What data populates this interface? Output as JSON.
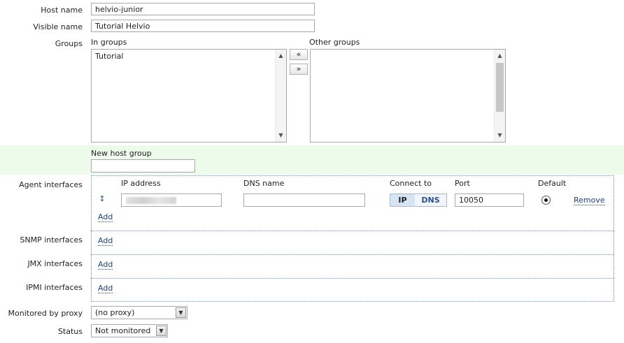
{
  "host": {
    "host_name_label": "Host name",
    "host_name_value": "helvio-junior",
    "visible_name_label": "Visible name",
    "visible_name_value": "Tutorial Helvio"
  },
  "groups": {
    "label": "Groups",
    "in_groups_label": "In groups",
    "in_groups_items": [
      "Tutorial"
    ],
    "other_groups_label": "Other groups",
    "move_left": "«",
    "move_right": "»"
  },
  "new_group": {
    "label": "New host group",
    "value": ""
  },
  "agent": {
    "label": "Agent interfaces",
    "headers": {
      "ip": "IP address",
      "dns": "DNS name",
      "connect": "Connect to",
      "port": "Port",
      "default": "Default"
    },
    "row": {
      "ip_value": "",
      "dns_value": "",
      "connect_ip": "IP",
      "connect_dns": "DNS",
      "port_value": "10050",
      "remove": "Remove"
    },
    "add": "Add"
  },
  "snmp": {
    "label": "SNMP interfaces",
    "add": "Add"
  },
  "jmx": {
    "label": "JMX interfaces",
    "add": "Add"
  },
  "ipmi": {
    "label": "IPMI interfaces",
    "add": "Add"
  },
  "proxy": {
    "label": "Monitored by proxy",
    "value": "(no proxy)"
  },
  "status": {
    "label": "Status",
    "value": "Not monitored"
  },
  "icons": {
    "drag": "drag-handle-icon",
    "dropdown": "chevron-down-icon",
    "radio": "radio-selected-icon"
  },
  "colors": {
    "accent_bg": "#ecfbea",
    "link": "#1f3f7a",
    "border_dotted": "#6d8fc2",
    "segment_active": "#d6e4f5"
  }
}
